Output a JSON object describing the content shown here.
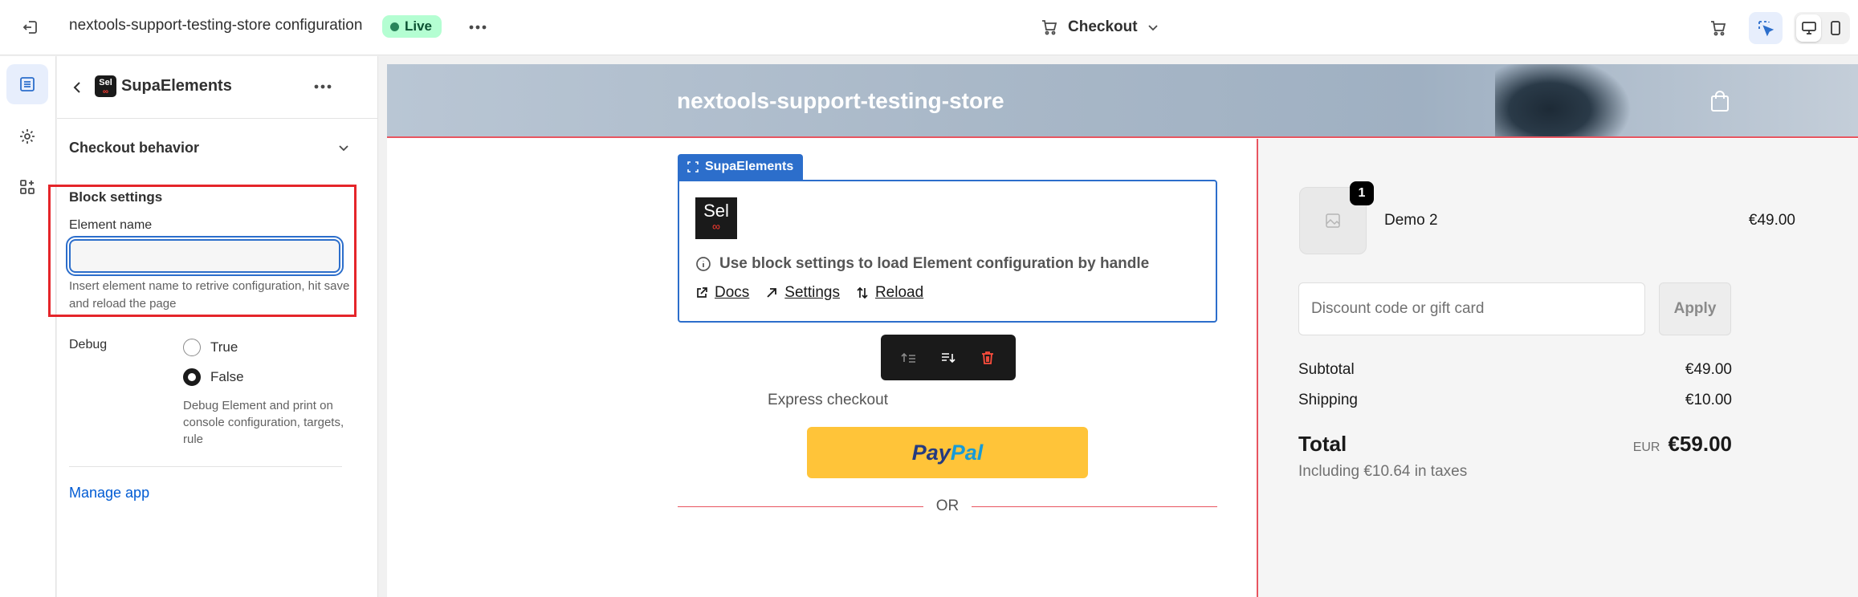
{
  "topbar": {
    "title": "nextools-support-testing-store configuration",
    "status_badge": "Live",
    "page_selector": "Checkout"
  },
  "panel": {
    "app_name": "SupaElements",
    "app_icon_text": "Sel",
    "section_title": "Checkout behavior",
    "block_settings_title": "Block settings",
    "element_name_label": "Element name",
    "element_name_value": "",
    "element_name_help": "Insert element name to retrive configuration, hit save and reload the page",
    "debug_label": "Debug",
    "debug_options": [
      "True",
      "False"
    ],
    "debug_selected": "False",
    "debug_help": "Debug Element and print on console configuration, targets, rule",
    "manage_app": "Manage app"
  },
  "preview": {
    "store_name": "nextools-support-testing-store",
    "block_tab": "SupaElements",
    "block_logo": "Sel",
    "block_message": "Use block settings to load Element configuration by handle",
    "links": [
      "Docs",
      "Settings",
      "Reload"
    ],
    "express_checkout": "Express checkout",
    "paypal": {
      "part1": "Pay",
      "part2": "Pal"
    },
    "or": "OR"
  },
  "summary": {
    "product_qty": "1",
    "product_name": "Demo 2",
    "product_price": "€49.00",
    "discount_placeholder": "Discount code or gift card",
    "apply": "Apply",
    "subtotal_label": "Subtotal",
    "subtotal_value": "€49.00",
    "shipping_label": "Shipping",
    "shipping_value": "€10.00",
    "total_label": "Total",
    "currency": "EUR",
    "total_value": "€59.00",
    "taxes": "Including €10.64 in taxes"
  },
  "colors": {
    "accent_blue": "#2c6ecb",
    "highlight_red": "#e5252a",
    "live_green": "#b4fed2",
    "paypal_yellow": "#ffc439"
  }
}
